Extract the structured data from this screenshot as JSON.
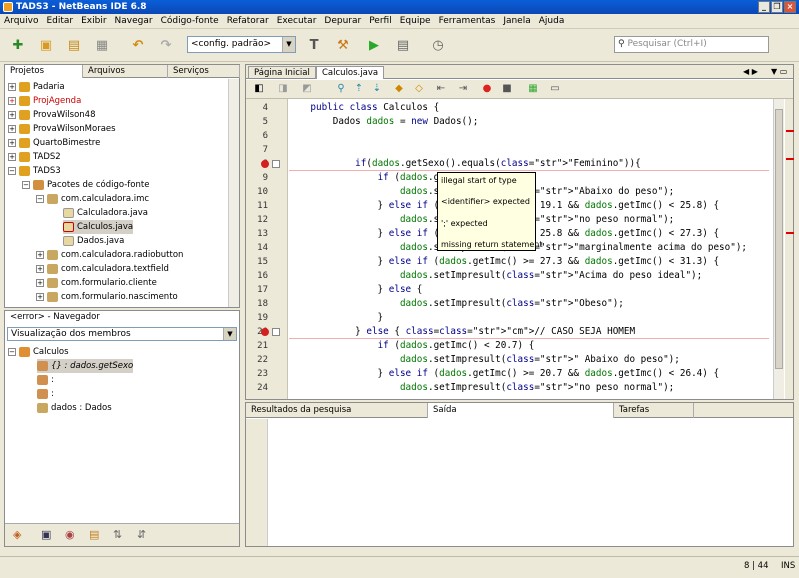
{
  "window": {
    "title": "TADS3 - NetBeans IDE 6.8",
    "minimize": "_",
    "restore": "❐",
    "close": "×"
  },
  "menu": [
    "Arquivo",
    "Editar",
    "Exibir",
    "Navegar",
    "Código-fonte",
    "Refatorar",
    "Executar",
    "Depurar",
    "Perfil",
    "Equipe",
    "Ferramentas",
    "Janela",
    "Ajuda"
  ],
  "toolbar": {
    "config_value": "<config. padrão>",
    "search_placeholder": "Pesquisar (Ctrl+I)"
  },
  "projects_panel": {
    "tabs": [
      "Projetos",
      "Arquivos",
      "Serviços"
    ],
    "tree": [
      {
        "label": "Padaria",
        "color": "#000000"
      },
      {
        "label": "ProjAgenda",
        "color": "#cc0000"
      },
      {
        "label": "ProvaWilson48",
        "color": "#000000"
      },
      {
        "label": "ProvaWilsonMoraes",
        "color": "#000000"
      },
      {
        "label": "QuartoBimestre",
        "color": "#000000"
      },
      {
        "label": "TADS2",
        "color": "#000000"
      },
      {
        "label": "TADS3",
        "color": "#000000"
      },
      {
        "label": "Pacotes de código-fonte",
        "color": "#000000"
      },
      {
        "label": "com.calculadora.imc",
        "color": "#000000"
      },
      {
        "label": "Calculadora.java",
        "color": "#000000"
      },
      {
        "label": "Calculos.java",
        "color": "#000000"
      },
      {
        "label": "Dados.java",
        "color": "#000000"
      },
      {
        "label": "com.calculadora.radiobutton",
        "color": "#000000"
      },
      {
        "label": "com.calculadora.textfield",
        "color": "#000000"
      },
      {
        "label": "com.formulario.cliente",
        "color": "#000000"
      },
      {
        "label": "com.formulario.nascimento",
        "color": "#000000"
      }
    ]
  },
  "navigator": {
    "title": "<error> - Navegador",
    "view": "Visualização dos membros",
    "root": "Calculos",
    "items": [
      "{} : dados.getSexo",
      ":",
      ":",
      "dados : Dados"
    ]
  },
  "editor": {
    "tabs": [
      "Página Inicial",
      "Calculos.java"
    ],
    "lines": [
      {
        "n": "4",
        "text": "    public class Calculos {"
      },
      {
        "n": "5",
        "text": "        Dados dados = new Dados();"
      },
      {
        "n": "6",
        "text": ""
      },
      {
        "n": "7",
        "text": ""
      },
      {
        "n": "8",
        "text": "            if(dados.getSexo().equals(\"Feminino\")){"
      },
      {
        "n": "9",
        "text": "                if (dados.getImc() < 19.1) {"
      },
      {
        "n": "10",
        "text": "                    dados.setImpresult(\"Abaixo do peso\");"
      },
      {
        "n": "11",
        "text": "                } else if (dados.getImc() >= 19.1 && dados.getImc() < 25.8) {"
      },
      {
        "n": "12",
        "text": "                    dados.setImpresult(\"no peso normal\");"
      },
      {
        "n": "13",
        "text": "                } else if (dados.getImc() >= 25.8 && dados.getImc() < 27.3) {"
      },
      {
        "n": "14",
        "text": "                    dados.setImpresult(\"marginalmente acima do peso\");"
      },
      {
        "n": "15",
        "text": "                } else if (dados.getImc() >= 27.3 && dados.getImc() < 31.3) {"
      },
      {
        "n": "16",
        "text": "                    dados.setImpresult(\"Acima do peso ideal\");"
      },
      {
        "n": "17",
        "text": "                } else {"
      },
      {
        "n": "18",
        "text": "                    dados.setImpresult(\"Obeso\");"
      },
      {
        "n": "19",
        "text": "                }"
      },
      {
        "n": "20",
        "text": "            } else { // CASO SEJA HOMEM"
      },
      {
        "n": "21",
        "text": "                if (dados.getImc() < 20.7) {"
      },
      {
        "n": "22",
        "text": "                    dados.setImpresult(\" Abaixo do peso\");"
      },
      {
        "n": "23",
        "text": "                } else if (dados.getImc() >= 20.7 && dados.getImc() < 26.4) {"
      },
      {
        "n": "24",
        "text": "                    dados.setImpresult(\"no peso normal\");"
      }
    ],
    "error_popup": [
      "illegal start of type",
      "<identifier> expected",
      "';' expected",
      "missing return statement"
    ]
  },
  "output": {
    "tabs": [
      "Resultados da pesquisa",
      "Saída",
      "Tarefas"
    ]
  },
  "status": {
    "position": "8 | 44",
    "mode": "INS"
  }
}
